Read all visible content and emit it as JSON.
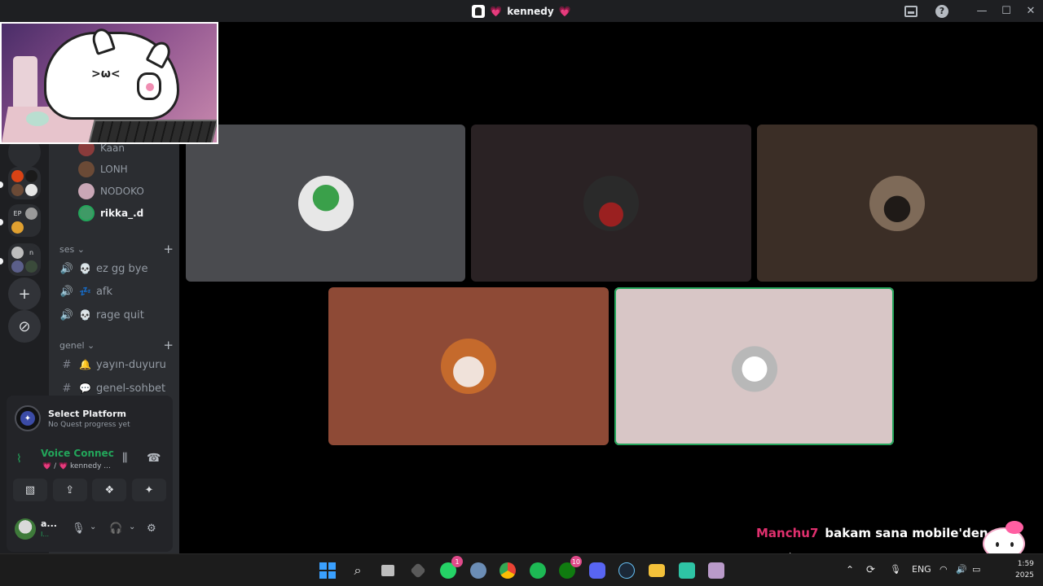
{
  "window": {
    "title": "kennedy",
    "title_prefix_heart": "💗",
    "title_suffix_heart": "💗",
    "minimize": "—",
    "maximize": "☐",
    "close": "✕",
    "help": "?"
  },
  "sidebar": {
    "members": [
      {
        "name": "Kaan",
        "color": "#8a3b3b",
        "active": false
      },
      {
        "name": "LONH",
        "color": "#6b4a36",
        "active": false
      },
      {
        "name": "NODOKO",
        "color": "#c9a7b6",
        "active": false
      },
      {
        "name": "rikka_.d",
        "color": "#3f9a66",
        "active": true
      }
    ],
    "categories": [
      {
        "name": "ses",
        "chevron": "⌄",
        "add": "+",
        "channels": [
          {
            "icon": "🔊",
            "emoji": "💀",
            "name": "ez gg bye"
          },
          {
            "icon": "🔊",
            "emoji": "💤",
            "name": "afk"
          },
          {
            "icon": "🔊",
            "emoji": "💀",
            "name": "rage quit"
          }
        ]
      },
      {
        "name": "genel",
        "chevron": "⌄",
        "add": "+",
        "channels": [
          {
            "icon": "#",
            "emoji": "🔔",
            "name": "yayın-duyuru"
          },
          {
            "icon": "#",
            "emoji": "💬",
            "name": "genel-sohbet"
          }
        ]
      }
    ]
  },
  "rail": {
    "folder_label": "EP",
    "folder2_label": "n",
    "add_server": "+",
    "explore": "⊘"
  },
  "quest": {
    "title": "Select Platform",
    "subtitle": "No Quest progress yet"
  },
  "voice": {
    "status": "Voice Connected",
    "channel": "💗 / 💗 kennedy ...",
    "buttons": [
      "▧",
      "⇪",
      "❖",
      "✦"
    ]
  },
  "user": {
    "name": "a...",
    "status": "I..."
  },
  "tiles": [
    {
      "bg": "#4a4b4f",
      "avatar": "#cfcfcf",
      "speaking": false
    },
    {
      "bg": "#2a2224",
      "avatar": "#3b2a2d",
      "speaking": false
    },
    {
      "bg": "#3b2e26",
      "avatar": "#5b4538",
      "speaking": false
    },
    {
      "bg": "#8e4a36",
      "avatar": "#d5894e",
      "speaking": false
    },
    {
      "bg": "#d8c6c6",
      "avatar": "#eadfe0",
      "speaking": true
    }
  ],
  "chat": {
    "user": "Manchu7",
    "message": "bakam sana mobile'den"
  },
  "taskbar": {
    "lang": "ENG",
    "time": "1:59",
    "date": "2025",
    "badge_whatsapp": "1",
    "badge_xbox": "10"
  }
}
